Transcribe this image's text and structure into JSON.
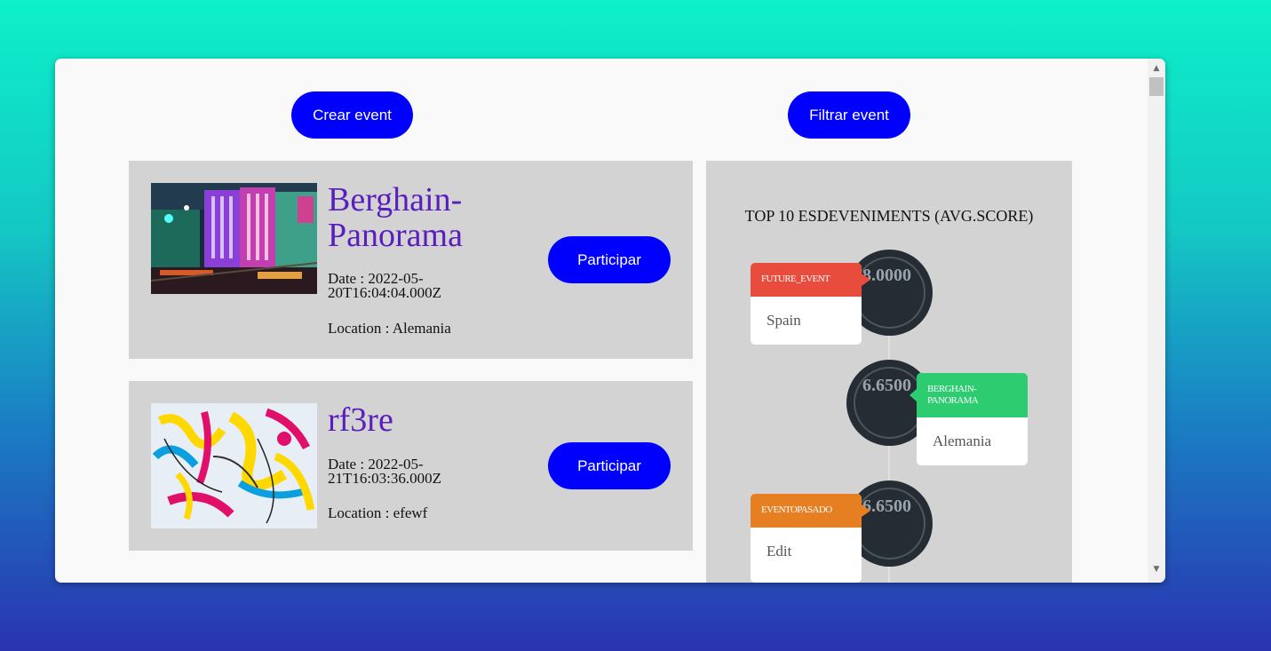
{
  "toolbar": {
    "create_label": "Crear event",
    "filter_label": "Filtrar event"
  },
  "events": [
    {
      "title": "Berghain-Panorama",
      "date": "Date : 2022-05-20T16:04:04.000Z",
      "location": "Location : Alemania",
      "button": "Participar"
    },
    {
      "title": "rf3re",
      "date": "Date : 2022-05-21T16:03:36.000Z",
      "location": "Location : efewf",
      "button": "Participar"
    }
  ],
  "ranking": {
    "title": "TOP 10 ESDEVENIMENTS (AVG.SCORE)",
    "items": [
      {
        "name": "FUTURE_EVENT",
        "location": "Spain",
        "score": "8.0000",
        "color": "#e74c3c"
      },
      {
        "name": "BERGHAIN-PANORAMA",
        "location": "Alemania",
        "score": "6.6500",
        "color": "#2ecc71"
      },
      {
        "name": "EVENTOPASADO",
        "location": "Edit",
        "score": "6.6500",
        "color": "#e67e22"
      }
    ]
  },
  "scrollbar": {
    "up_icon": "triangle-up",
    "down_icon": "triangle-down"
  }
}
